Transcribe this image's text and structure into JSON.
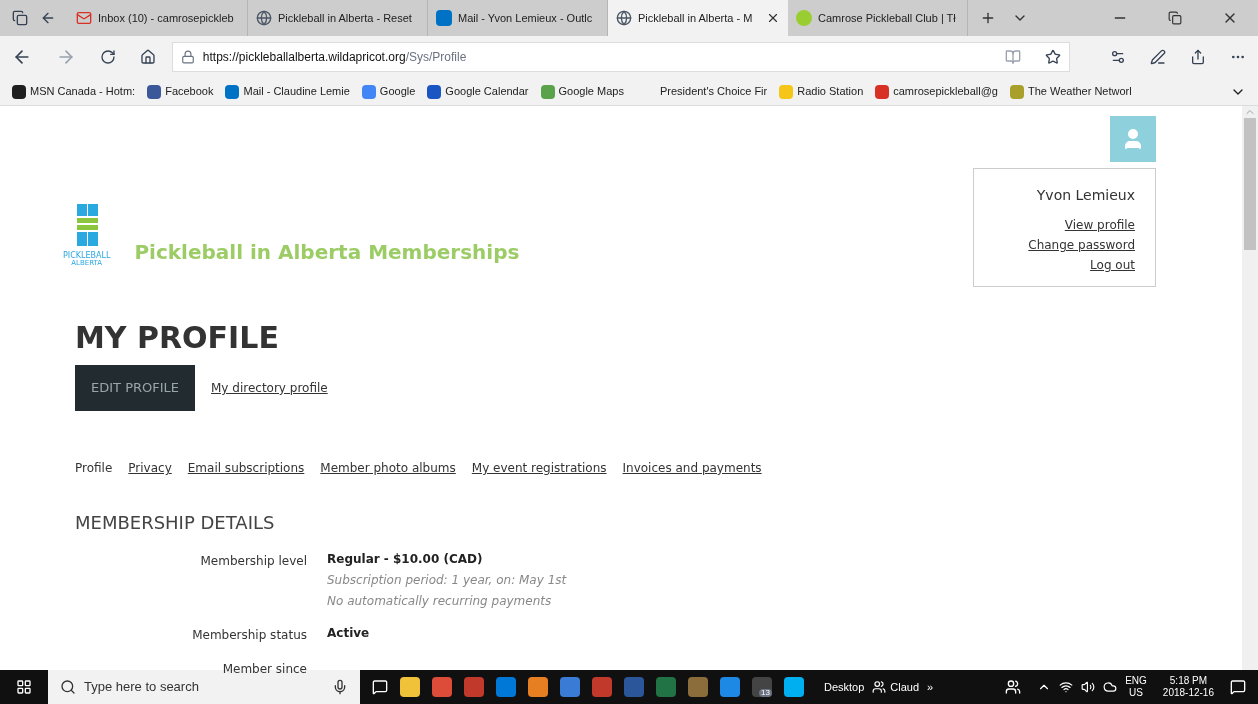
{
  "browser": {
    "tabs": [
      {
        "title": "Inbox (10) - camrosepickleb",
        "kind": "mail",
        "selected": false
      },
      {
        "title": "Pickleball in Alberta - Reset",
        "kind": "globe",
        "selected": false
      },
      {
        "title": "Mail - Yvon Lemieux - Outlc",
        "kind": "outlook",
        "selected": false
      },
      {
        "title": "Pickleball in Alberta - M",
        "kind": "globe",
        "selected": true
      },
      {
        "title": "Camrose Pickleball Club | Tł",
        "kind": "ball",
        "selected": false
      }
    ],
    "url_host": "https://pickleballalberta.wildapricot.org",
    "url_path": "/Sys/Profile",
    "bookmarks": [
      {
        "label": "MSN Canada - Hotm:",
        "color": "#1f1f1f"
      },
      {
        "label": "Facebook",
        "color": "#3b5998"
      },
      {
        "label": "Mail - Claudine Lemie",
        "color": "#0072c6"
      },
      {
        "label": "Google",
        "color": "#4285f4"
      },
      {
        "label": "Google Calendar",
        "color": "#1a55c4"
      },
      {
        "label": "Google Maps",
        "color": "#5aa34a"
      },
      {
        "label": "President's Choice Fir"
      },
      {
        "label": "Radio Station",
        "color": "#f5c518"
      },
      {
        "label": "camrosepickleball@g",
        "color": "#d93025"
      },
      {
        "label": "The Weather Networl",
        "color": "#a8a02a"
      }
    ]
  },
  "page": {
    "logo_text": "PICKLEBALL",
    "logo_subtext": "ALBERTA",
    "site_title": "Pickleball in Alberta Memberships",
    "user_menu": {
      "name": "Yvon Lemieux",
      "links": [
        "View profile",
        "Change password",
        "Log out"
      ]
    },
    "heading": "MY PROFILE",
    "actions": [
      {
        "label": "EDIT PROFILE",
        "kind": "button"
      },
      {
        "label": "My directory profile",
        "kind": "link"
      }
    ],
    "subnav": [
      {
        "label": "Profile",
        "selected": true
      },
      {
        "label": "Privacy",
        "selected": false
      },
      {
        "label": "Email subscriptions",
        "selected": false
      },
      {
        "label": "Member photo albums",
        "selected": false
      },
      {
        "label": "My event registrations",
        "selected": false
      },
      {
        "label": "Invoices and payments",
        "selected": false
      }
    ],
    "section_title": "MEMBERSHIP DETAILS",
    "fields": [
      {
        "label": "Membership level",
        "lines": [
          {
            "text": "Regular - $10.00 (CAD)",
            "kind": "value"
          },
          {
            "text": "Subscription period: 1 year, on: May 1st",
            "kind": "note"
          },
          {
            "text": "No automatically recurring payments",
            "kind": "note"
          }
        ]
      },
      {
        "label": "Membership status",
        "lines": [
          {
            "text": "Active",
            "kind": "value"
          }
        ]
      },
      {
        "label": "Member since"
      }
    ]
  },
  "taskbar": {
    "search_placeholder": "Type here to search",
    "apps": [
      {
        "color": "#f0c23a"
      },
      {
        "color": "#dd4b39"
      },
      {
        "color": "#c0392b"
      },
      {
        "color": "#0078d7"
      },
      {
        "color": "#e67e22"
      },
      {
        "color": "#3a7bd5"
      },
      {
        "color": "#c0392b"
      },
      {
        "color": "#2b579a"
      },
      {
        "color": "#217346"
      },
      {
        "color": "#8a6d3b"
      },
      {
        "color": "#1e88e5"
      },
      {
        "color": "#444444",
        "badge": "13"
      },
      {
        "color": "#00aff0"
      }
    ],
    "desktop": "Desktop",
    "user": "Claud",
    "more": "»",
    "lang": "ENG",
    "region": "US",
    "time": "5:18 PM",
    "date": "2018-12-16"
  }
}
